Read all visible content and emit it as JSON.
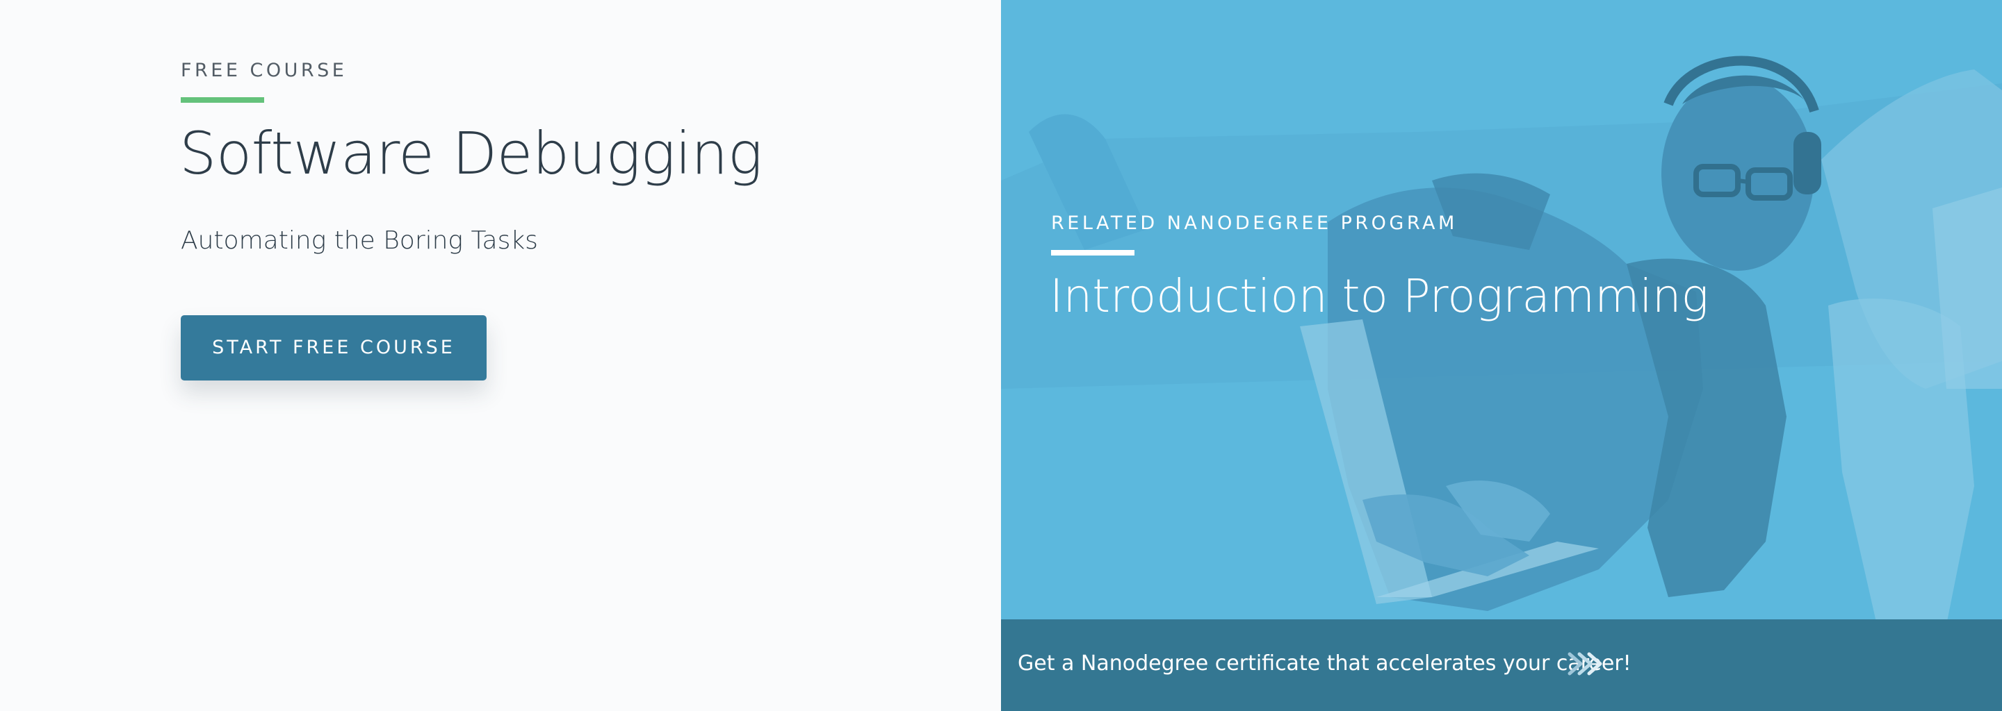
{
  "course": {
    "eyebrow": "FREE COURSE",
    "title": "Software Debugging",
    "subtitle": "Automating the Boring Tasks",
    "start_label": "START FREE COURSE"
  },
  "related": {
    "eyebrow": "RELATED NANODEGREE PROGRAM",
    "title": "Introduction to Programming",
    "cta_text": "Get a Nanodegree certificate that accelerates your career!",
    "cta_icon": "double-chevron-right-icon",
    "hero_image": "person-with-headphones-using-laptop"
  },
  "colors": {
    "accent_green": "#64c27b",
    "button_blue": "#347a9b",
    "panel_blue": "#5bb7dd",
    "cta_blue": "#347792",
    "text_dark": "#2e3d49"
  }
}
